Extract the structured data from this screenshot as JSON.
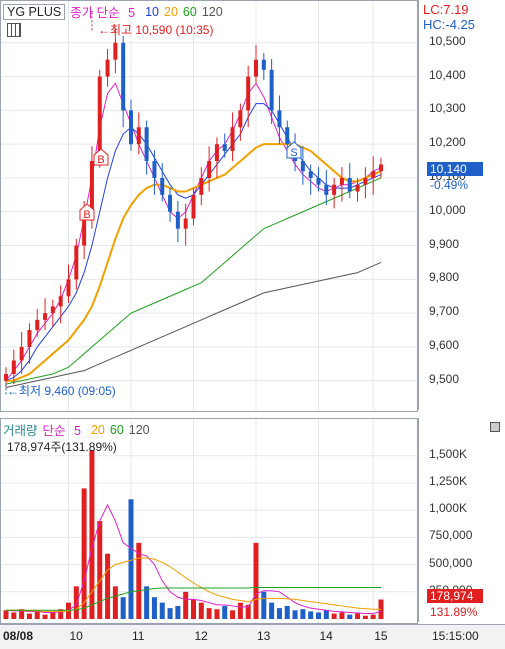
{
  "price_panel": {
    "legend": {
      "name": "YG PLUS",
      "type": "종가 단순",
      "p5": "5",
      "p10": "10",
      "p20": "20",
      "p60": "60",
      "p120": "120"
    },
    "high_label": "최고 10,590 (10:35)",
    "low_label": "최저 9,460 (09:05)",
    "lc": "LC:7.19",
    "hc": "HC:-4.25",
    "current_price": "10,140",
    "current_change": "-0.49%",
    "y_ticks": [
      "10,500",
      "10,400",
      "10,300",
      "10,200",
      "10,100",
      "10,000",
      "9,900",
      "9,800",
      "9,700",
      "9,600",
      "9,500"
    ],
    "buy_marker": "B",
    "sell_marker": "S"
  },
  "volume_panel": {
    "legend": {
      "name": "거래량",
      "type": "단순",
      "p5": "5",
      "p20": "20",
      "p60": "60",
      "p120": "120"
    },
    "summary": "178,974주(131.89%)",
    "current_volume": "178,974",
    "current_ratio": "131.89%",
    "y_ticks": [
      "1,500K",
      "1,250K",
      "1,000K",
      "750,000",
      "500,000",
      "250,000"
    ]
  },
  "time_axis": {
    "labels": [
      "08/08",
      "10",
      "11",
      "12",
      "13",
      "14",
      "15"
    ],
    "clock": "15:15:00"
  },
  "colors": {
    "up": "#e02020",
    "down": "#1e5fc8",
    "ma5": "#e020c8",
    "ma10": "#2040e0",
    "ma20": "#f0a000",
    "ma60": "#20a020",
    "ma120": "#555555"
  },
  "chart_data": [
    {
      "type": "candlestick",
      "title": "YG PLUS",
      "ylim": [
        9440,
        10600
      ],
      "high": {
        "value": 10590,
        "time": "10:35"
      },
      "low": {
        "value": 9460,
        "time": "09:05"
      },
      "last": 10140,
      "x": [
        "08/08",
        "10",
        "11",
        "12",
        "13",
        "14",
        "15"
      ],
      "series": [
        {
          "name": "종가",
          "values": [
            9520,
            9560,
            9600,
            9650,
            9680,
            9700,
            9720,
            9750,
            9800,
            9900,
            10000,
            10150,
            10400,
            10450,
            10500,
            10300,
            10200,
            10250,
            10150,
            10100,
            10050,
            10000,
            9950,
            9980,
            10050,
            10100,
            10150,
            10200,
            10180,
            10250,
            10300,
            10400,
            10450,
            10420,
            10300,
            10250,
            10200,
            10150,
            10120,
            10100,
            10080,
            10050,
            10080,
            10100,
            10060,
            10080,
            10100,
            10120,
            10140
          ]
        },
        {
          "name": "5",
          "values": [
            9500,
            9530,
            9560,
            9600,
            9640,
            9670,
            9700,
            9740,
            9800,
            9870,
            9980,
            10100,
            10250,
            10350,
            10380,
            10320,
            10260,
            10200,
            10150,
            10100,
            10050,
            10000,
            9980,
            10000,
            10050,
            10100,
            10150,
            10180,
            10200,
            10240,
            10290,
            10350,
            10380,
            10340,
            10280,
            10220,
            10180,
            10140,
            10110,
            10090,
            10070,
            10060,
            10070,
            10080,
            10080,
            10090,
            10100,
            10120,
            10130
          ]
        },
        {
          "name": "10",
          "values": [
            9500,
            9510,
            9530,
            9560,
            9600,
            9630,
            9660,
            9690,
            9720,
            9760,
            9820,
            9900,
            10000,
            10100,
            10180,
            10230,
            10250,
            10230,
            10200,
            10160,
            10120,
            10080,
            10050,
            10040,
            10050,
            10080,
            10110,
            10140,
            10170,
            10200,
            10230,
            10280,
            10320,
            10320,
            10300,
            10260,
            10220,
            10180,
            10150,
            10120,
            10100,
            10080,
            10070,
            10070,
            10070,
            10080,
            10090,
            10100,
            10110
          ]
        },
        {
          "name": "20",
          "values": [
            9500,
            9500,
            9510,
            9520,
            9540,
            9560,
            9580,
            9600,
            9620,
            9650,
            9680,
            9720,
            9780,
            9850,
            9920,
            9980,
            10020,
            10050,
            10070,
            10080,
            10080,
            10070,
            10060,
            10060,
            10070,
            10080,
            10090,
            10100,
            10110,
            10130,
            10150,
            10170,
            10190,
            10200,
            10200,
            10200,
            10200,
            10200,
            10190,
            10180,
            10160,
            10140,
            10120,
            10100,
            10090,
            10090,
            10100,
            10110,
            10120
          ]
        },
        {
          "name": "60",
          "values": [
            9490,
            9495,
            9500,
            9505,
            9510,
            9515,
            9520,
            9530,
            9540,
            9560,
            9580,
            9600,
            9620,
            9640,
            9660,
            9680,
            9700,
            9710,
            9720,
            9730,
            9740,
            9750,
            9760,
            9770,
            9780,
            9790,
            9810,
            9830,
            9850,
            9870,
            9890,
            9910,
            9930,
            9950,
            9960,
            9970,
            9980,
            9990,
            10000,
            10010,
            10020,
            10030,
            10040,
            10050,
            10060,
            10070,
            10080,
            10090,
            10100
          ]
        },
        {
          "name": "120",
          "values": [
            9480,
            9485,
            9490,
            9495,
            9500,
            9505,
            9510,
            9515,
            9520,
            9525,
            9530,
            9540,
            9550,
            9560,
            9570,
            9580,
            9590,
            9600,
            9610,
            9620,
            9630,
            9640,
            9650,
            9660,
            9670,
            9680,
            9690,
            9700,
            9710,
            9720,
            9730,
            9740,
            9750,
            9760,
            9765,
            9770,
            9775,
            9780,
            9785,
            9790,
            9795,
            9800,
            9805,
            9810,
            9815,
            9820,
            9830,
            9840,
            9850
          ]
        }
      ]
    },
    {
      "type": "bar",
      "title": "거래량",
      "ylim": [
        0,
        1700000
      ],
      "x": [
        "08/08",
        "10",
        "11",
        "12",
        "13",
        "14",
        "15"
      ],
      "series": [
        {
          "name": "거래량",
          "values": [
            80000,
            60000,
            90000,
            50000,
            70000,
            40000,
            60000,
            90000,
            150000,
            300000,
            1200000,
            1550000,
            900000,
            600000,
            300000,
            200000,
            1100000,
            700000,
            300000,
            200000,
            150000,
            100000,
            120000,
            250000,
            180000,
            150000,
            100000,
            90000,
            120000,
            80000,
            150000,
            130000,
            700000,
            250000,
            150000,
            100000,
            120000,
            80000,
            90000,
            70000,
            60000,
            80000,
            50000,
            60000,
            40000,
            50000,
            30000,
            40000,
            178974
          ]
        },
        {
          "name": "5",
          "values": [
            80000,
            75000,
            76000,
            68000,
            70000,
            60000,
            60000,
            65000,
            80000,
            130000,
            350000,
            650000,
            900000,
            1050000,
            900000,
            700000,
            650000,
            600000,
            580000,
            500000,
            350000,
            250000,
            200000,
            180000,
            180000,
            170000,
            150000,
            130000,
            130000,
            120000,
            110000,
            110000,
            230000,
            260000,
            260000,
            250000,
            200000,
            150000,
            120000,
            100000,
            90000,
            80000,
            70000,
            65000,
            60000,
            55000,
            50000,
            50000,
            70000
          ]
        },
        {
          "name": "20",
          "values": [
            80000,
            80000,
            80000,
            75000,
            75000,
            70000,
            70000,
            70000,
            75000,
            90000,
            150000,
            250000,
            350000,
            450000,
            500000,
            520000,
            540000,
            560000,
            560000,
            550000,
            520000,
            480000,
            430000,
            380000,
            330000,
            290000,
            250000,
            220000,
            200000,
            180000,
            170000,
            160000,
            180000,
            190000,
            190000,
            190000,
            185000,
            180000,
            170000,
            160000,
            150000,
            140000,
            130000,
            120000,
            110000,
            100000,
            95000,
            90000,
            90000
          ]
        },
        {
          "name": "60",
          "values": [
            80000,
            80000,
            80000,
            80000,
            80000,
            80000,
            80000,
            80000,
            80000,
            85000,
            100000,
            130000,
            160000,
            190000,
            210000,
            230000,
            250000,
            260000,
            270000,
            280000,
            285000,
            285000,
            285000,
            285000,
            285000,
            285000,
            285000,
            285000,
            285000,
            285000,
            285000,
            285000,
            290000,
            290000,
            290000,
            290000,
            290000,
            290000,
            290000,
            290000,
            290000,
            290000,
            290000,
            290000,
            290000,
            290000,
            290000,
            290000,
            290000
          ]
        }
      ]
    }
  ]
}
